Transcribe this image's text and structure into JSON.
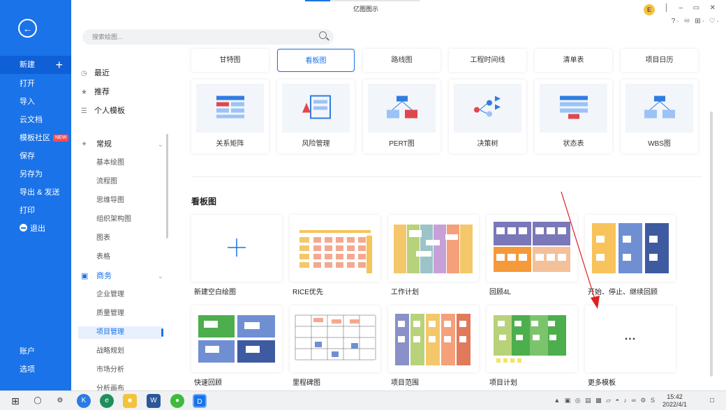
{
  "app": {
    "title": "亿图图示"
  },
  "search": {
    "placeholder": "搜索绘图..."
  },
  "left_nav": {
    "items": [
      {
        "label": "新建",
        "key": "new"
      },
      {
        "label": "打开",
        "key": "open"
      },
      {
        "label": "导入",
        "key": "import"
      },
      {
        "label": "云文档",
        "key": "cloud"
      },
      {
        "label": "模板社区",
        "key": "community",
        "badge": "NEW"
      },
      {
        "label": "保存",
        "key": "save"
      },
      {
        "label": "另存为",
        "key": "saveas"
      },
      {
        "label": "导出 & 发送",
        "key": "export"
      },
      {
        "label": "打印",
        "key": "print"
      },
      {
        "label": "退出",
        "key": "exit"
      }
    ],
    "bottom": [
      {
        "label": "账户",
        "key": "account"
      },
      {
        "label": "选项",
        "key": "options"
      }
    ]
  },
  "col2": {
    "quick": [
      {
        "label": "最近",
        "icon": "clock-icon"
      },
      {
        "label": "推荐",
        "icon": "star-icon"
      },
      {
        "label": "个人模板",
        "icon": "template-icon"
      }
    ],
    "groups": [
      {
        "label": "常规",
        "items": [
          "基本绘图",
          "流程图",
          "思维导图",
          "组织架构图",
          "图表",
          "表格"
        ]
      },
      {
        "label": "商务",
        "items": [
          "企业管理",
          "质量管理",
          "项目管理",
          "战略规划",
          "市场分析",
          "分析画布"
        ]
      }
    ],
    "selected": "项目管理"
  },
  "category_tabs": [
    {
      "label": "甘特图",
      "active": false
    },
    {
      "label": "看板图",
      "active": true
    },
    {
      "label": "路线图",
      "active": false
    },
    {
      "label": "工程时间线",
      "active": false
    },
    {
      "label": "清单表",
      "active": false
    },
    {
      "label": "项目日历",
      "active": false
    }
  ],
  "diagram_types": [
    {
      "label": "关系矩阵",
      "icon": "matrix-icon"
    },
    {
      "label": "风险管理",
      "icon": "risk-icon"
    },
    {
      "label": "PERT图",
      "icon": "pert-icon"
    },
    {
      "label": "决策树",
      "icon": "decision-tree-icon"
    },
    {
      "label": "状态表",
      "icon": "state-table-icon"
    },
    {
      "label": "WBS图",
      "icon": "wbs-icon"
    }
  ],
  "section": {
    "title": "看板图"
  },
  "templates": [
    {
      "label": "新建空白绘图",
      "kind": "blank"
    },
    {
      "label": "RICE优先",
      "kind": "rice"
    },
    {
      "label": "工作计划",
      "kind": "workplan"
    },
    {
      "label": "回顾4L",
      "kind": "retro4l"
    },
    {
      "label": "开始、停止、继续回顾",
      "kind": "startstop"
    },
    {
      "label": "快速回顾",
      "kind": "quickretro"
    },
    {
      "label": "里程碑图",
      "kind": "milestone"
    },
    {
      "label": "项目范围",
      "kind": "scope"
    },
    {
      "label": "项目计划",
      "kind": "projectplan"
    },
    {
      "label": "更多模板",
      "kind": "more"
    }
  ],
  "more_glyph": "...",
  "blank_glyph": "+",
  "taskbar": {
    "time": "15:42",
    "date": "2022/4/1"
  },
  "colors": {
    "brand": "#1a73e8",
    "new_badge": "#ff4d4f",
    "annotation_arrow": "#e02020"
  }
}
